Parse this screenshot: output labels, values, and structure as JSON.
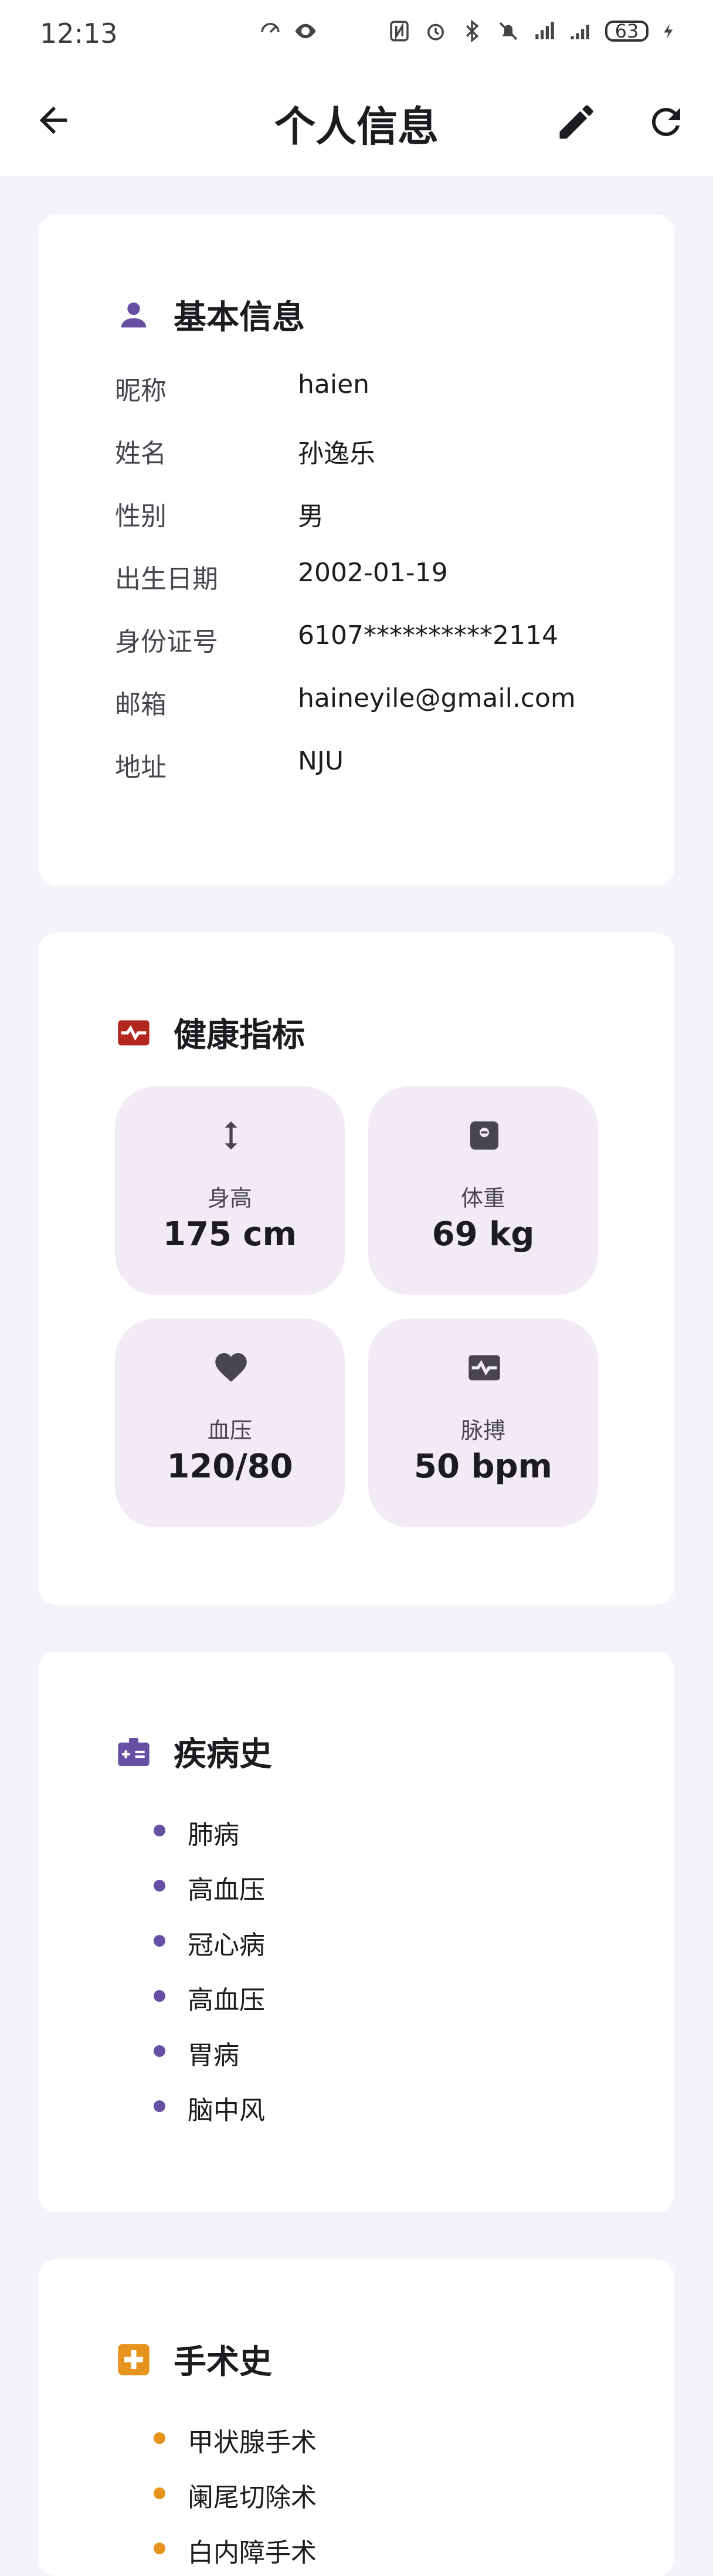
{
  "status_bar": {
    "time": "12:13",
    "battery": "63"
  },
  "app_bar": {
    "title": "个人信息"
  },
  "basic_info": {
    "title": "基本信息",
    "rows": [
      {
        "label": "昵称",
        "value": "haien"
      },
      {
        "label": "姓名",
        "value": "孙逸乐"
      },
      {
        "label": "性别",
        "value": "男"
      },
      {
        "label": "出生日期",
        "value": "2002-01-19"
      },
      {
        "label": "身份证号",
        "value": "6107**********2114"
      },
      {
        "label": "邮箱",
        "value": "haineyile@gmail.com"
      },
      {
        "label": "地址",
        "value": "NJU"
      }
    ]
  },
  "health": {
    "title": "健康指标",
    "tiles": [
      {
        "label": "身高",
        "value": "175 cm",
        "icon": "height-icon"
      },
      {
        "label": "体重",
        "value": "69 kg",
        "icon": "scale-icon"
      },
      {
        "label": "血压",
        "value": "120/80",
        "icon": "heart-icon"
      },
      {
        "label": "脉搏",
        "value": "50 bpm",
        "icon": "pulse-icon"
      }
    ]
  },
  "disease_history": {
    "title": "疾病史",
    "items": [
      "肺病",
      "高血压",
      "冠心病",
      "高血压",
      "胃病",
      "脑中风"
    ]
  },
  "surgery_history": {
    "title": "手术史",
    "items": [
      "甲状腺手术",
      "阑尾切除术",
      "白内障手术"
    ]
  },
  "colors": {
    "accent_purple": "#6750a4",
    "health_red": "#b3261e",
    "surgery_orange": "#e6941e",
    "tile_bg": "#f0ebf5"
  }
}
